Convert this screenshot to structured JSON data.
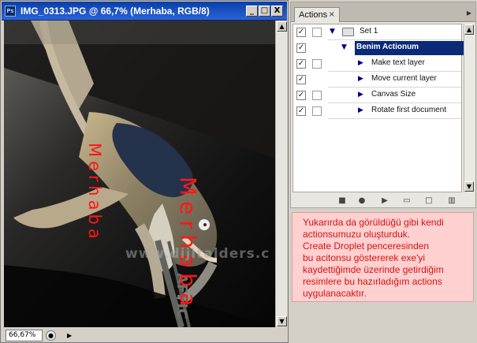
{
  "document": {
    "title": "IMG_0313.JPG @ 66,7% (Merhaba, RGB/8)",
    "zoom_display": "66,67%",
    "controls": {
      "minimize": "_",
      "maximize": "□",
      "close": "X"
    }
  },
  "actions_panel": {
    "tab_label": "Actions",
    "tab_close": "×",
    "rows": [
      {
        "label": "Set 1"
      },
      {
        "label": "Benim Actionum"
      },
      {
        "label": "Make text layer"
      },
      {
        "label": "Move current layer"
      },
      {
        "label": "Canvas Size"
      },
      {
        "label": "Rotate first document"
      }
    ]
  },
  "image_text": {
    "red_letters_left": "Merhaba",
    "red_letters_right": "Merhaba",
    "watermark": "www.dijitalders.c"
  },
  "note": {
    "lines": [
      "Yukarırda da görüldüğü gibi kendi",
      "actionsumuzu oluşturduk.",
      "Create Droplet penceresinden",
      "bu acitonsu göstererek exe'yi",
      "kaydettiğimde üzerinde getirdiğim",
      "resimlere bu hazırladığım actions",
      "uygulanacaktır."
    ]
  },
  "colors": {
    "title_bar": "#0a3fa8",
    "selected_action": "#0a2a78",
    "note_background": "#ffd0d0",
    "note_text": "#d51212",
    "image_red_text": "#ff1717"
  }
}
